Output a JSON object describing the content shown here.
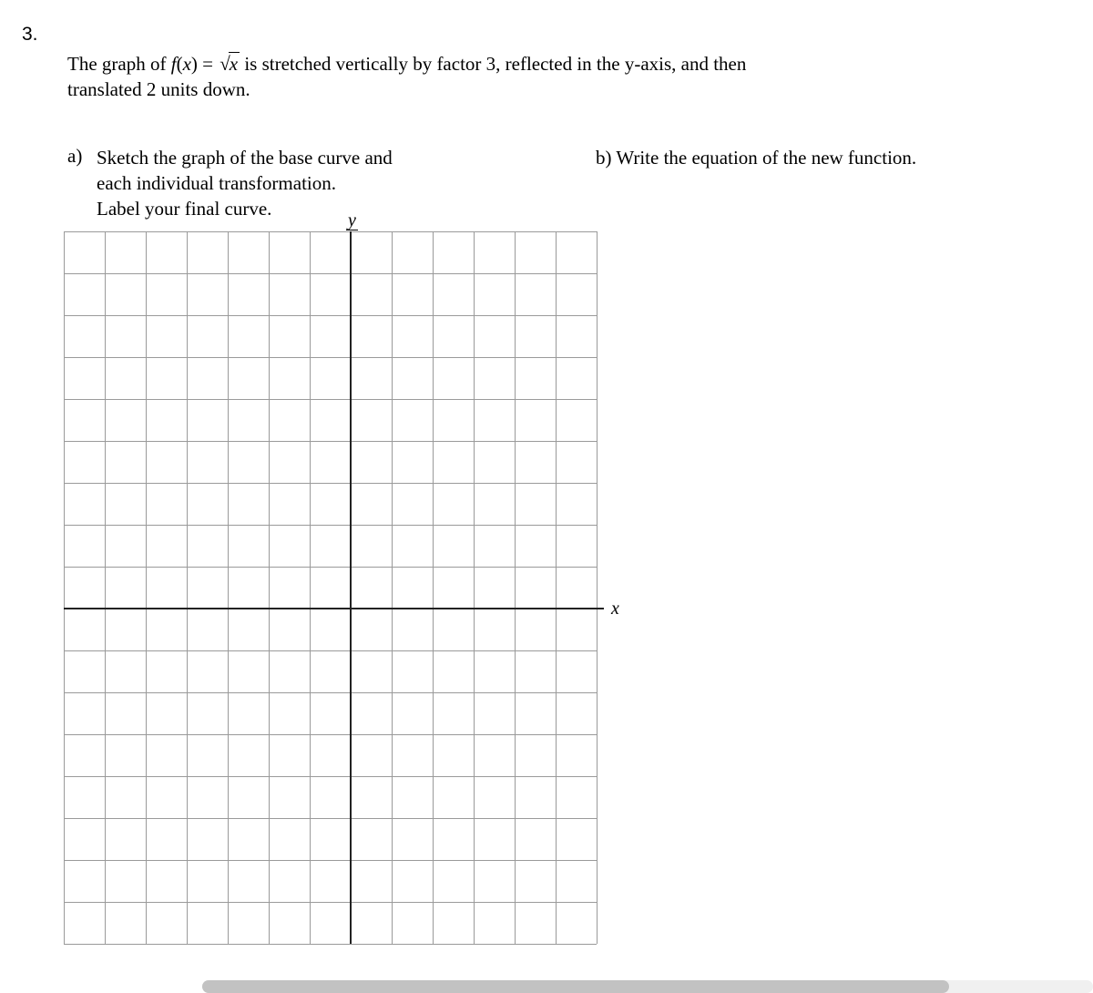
{
  "question": {
    "number": "3.",
    "stem_pre": "The graph of ",
    "stem_fn": "f",
    "stem_paren_open": "(",
    "stem_var": "x",
    "stem_paren_close": ")",
    "stem_eq": "= ",
    "stem_radicand": "x",
    "stem_post1": " is stretched vertically by factor 3, reflected in the y-axis, and then",
    "stem_post2": "translated 2 units down."
  },
  "parts": {
    "a": {
      "letter": "a)",
      "line1": "Sketch the graph of the base curve and",
      "line2": "each individual transformation.",
      "line3": "Label your final curve."
    },
    "b": {
      "text": "b) Write the equation of the new function."
    }
  },
  "chart_data": {
    "type": "grid",
    "title": "",
    "xlabel": "x",
    "ylabel": "y",
    "grid_cols": 13,
    "grid_rows": 17,
    "origin_col": 7,
    "origin_row_from_top": 9,
    "xlim": [
      -7,
      6
    ],
    "ylim": [
      -8,
      9
    ],
    "series": []
  }
}
